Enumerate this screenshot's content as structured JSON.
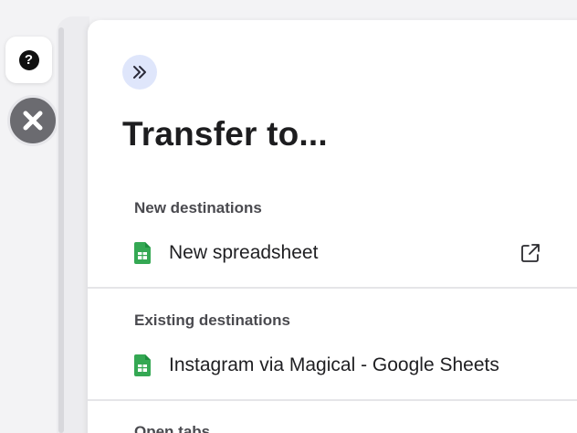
{
  "panel": {
    "title": "Transfer to...",
    "sections": [
      {
        "label": "New destinations",
        "items": [
          {
            "label": "New spreadsheet",
            "icon": "google-sheets-icon",
            "action_icon": "external-link-icon"
          }
        ]
      },
      {
        "label": "Existing destinations",
        "items": [
          {
            "label": "Instagram via Magical - Google Sheets",
            "icon": "google-sheets-icon"
          }
        ]
      },
      {
        "label": "Open tabs",
        "items": []
      }
    ]
  },
  "rail": {
    "help_glyph": "?"
  },
  "colors": {
    "sheets_green": "#34a853",
    "collapse_bg": "#dfe6fb",
    "close_bg": "#6b6b70"
  }
}
